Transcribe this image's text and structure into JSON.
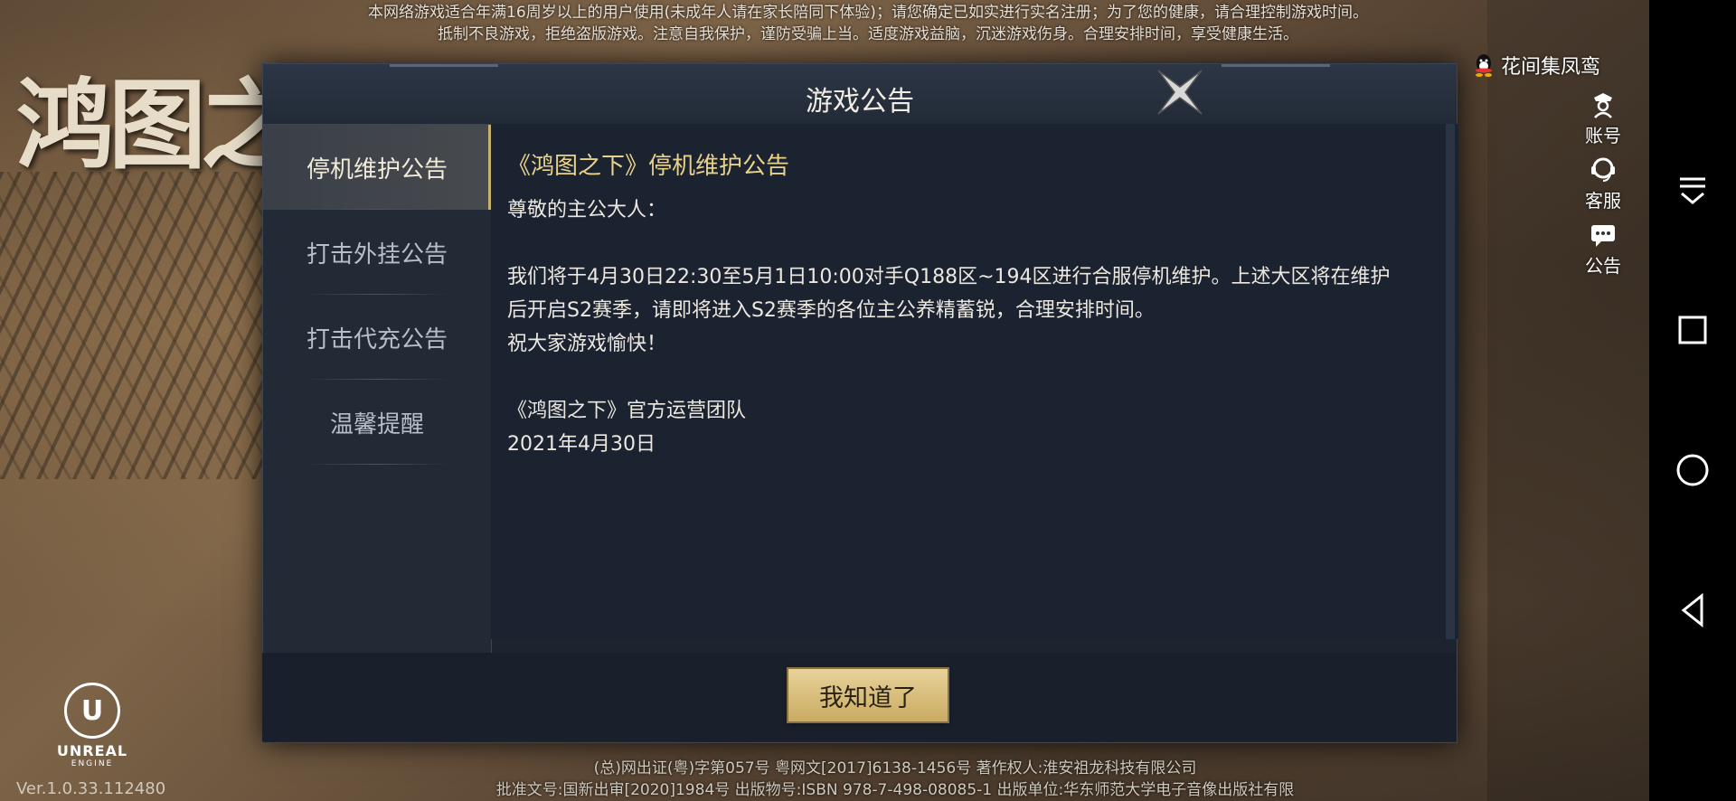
{
  "notice": {
    "line1": "本网络游戏适合年满16周岁以上的用户使用(未成年人请在家长陪同下体验)；请您确定已如实进行实名注册；为了您的健康，请合理控制游戏时间。",
    "line2": "抵制不良游戏，拒绝盗版游戏。注意自我保护，谨防受骗上当。适度游戏益脑，沉迷游戏伤身。合理安排时间，享受健康生活。"
  },
  "logo": {
    "text": "鸿图之"
  },
  "user": {
    "name": "花间集凤鸾",
    "icon": "qq-icon"
  },
  "side_menu": [
    {
      "label": "账号",
      "icon": "account-icon"
    },
    {
      "label": "客服",
      "icon": "customer-service-icon"
    },
    {
      "label": "公告",
      "icon": "announcement-icon"
    }
  ],
  "dialog": {
    "title": "游戏公告",
    "tabs": [
      {
        "label": "停机维护公告",
        "active": true
      },
      {
        "label": "打击外挂公告",
        "active": false
      },
      {
        "label": "打击代充公告",
        "active": false
      },
      {
        "label": "温馨提醒",
        "active": false
      }
    ],
    "content": {
      "title": "《鸿图之下》停机维护公告",
      "lines": [
        "尊敬的主公大人：",
        "",
        "我们将于4月30日22:30至5月1日10:00对手Q188区~194区进行合服停机维护。上述大区将在维护",
        "后开启S2赛季，请即将进入S2赛季的各位主公养精蓄锐，合理安排时间。",
        "祝大家游戏愉快！",
        "",
        "《鸿图之下》官方运营团队",
        "2021年4月30日"
      ]
    },
    "ok_label": "我知道了"
  },
  "engine": {
    "name": "UNREAL",
    "sub": "ENGINE"
  },
  "footer": {
    "line1": "(总)网出证(粤)字第057号 粤网文[2017]6138-1456号 著作权人:淮安祖龙科技有限公司",
    "line2": "批准文号:国新出审[2020]1984号  出版物号:ISBN 978-7-498-08085-1  出版单位:华东师范大学电子音像出版社有限"
  },
  "version": "Ver.1.0.33.112480",
  "colors": {
    "accent_gold": "#e9d28a",
    "button_gold": "#d8bd7a",
    "panel": "#1d2430"
  }
}
